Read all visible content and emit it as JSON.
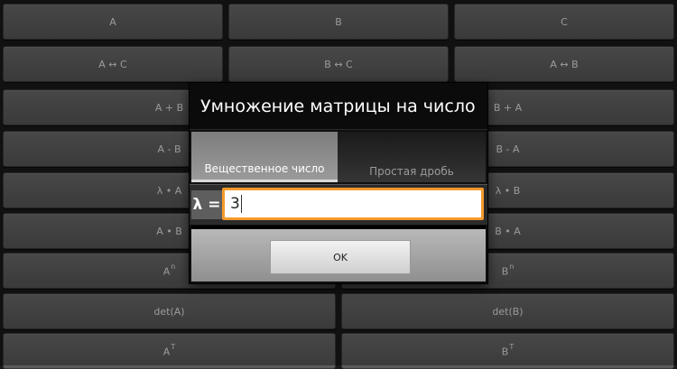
{
  "grid": {
    "row1": [
      "A",
      "B",
      "C"
    ],
    "row2": [
      "A ↔ C",
      "B ↔ C",
      "A ↔ B"
    ],
    "left": [
      "A + B",
      "A - B",
      "λ • A",
      "A • B"
    ],
    "right": [
      "B + A",
      "B - A",
      "λ • B",
      "B • A"
    ],
    "power_a": {
      "base": "A",
      "sup": "n"
    },
    "power_b": {
      "base": "B",
      "sup": "n"
    },
    "det_a": "det(A)",
    "det_b": "det(B)",
    "transpose_a": {
      "base": "A",
      "sup": "T"
    },
    "transpose_b": {
      "base": "B",
      "sup": "T"
    }
  },
  "dialog": {
    "title": "Умножение матрицы на число",
    "tabs": [
      "Вещественное число",
      "Простая дробь"
    ],
    "lambda_label": "λ =",
    "input_value": "3",
    "ok_label": "OK"
  }
}
